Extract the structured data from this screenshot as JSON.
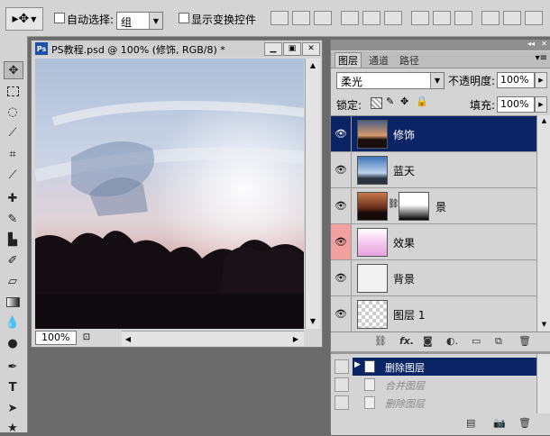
{
  "options_bar": {
    "auto_select_label": "自动选择:",
    "auto_select_value": "组",
    "show_transform_label": "显示变换控件"
  },
  "document": {
    "title": "PS教程.psd @ 100% (修饰, RGB/8) *",
    "zoom": "100%"
  },
  "layers_panel": {
    "tabs": [
      "图层",
      "通道",
      "路径"
    ],
    "blend_mode": "柔光",
    "opacity_label": "不透明度:",
    "opacity_value": "100%",
    "lock_label": "锁定:",
    "fill_label": "填充:",
    "fill_value": "100%",
    "layers": [
      {
        "name": "修饰",
        "selected": true,
        "thumb": "sunset"
      },
      {
        "name": "蓝天",
        "selected": false,
        "thumb": "sky"
      },
      {
        "name": "景",
        "selected": false,
        "thumb": "landscape",
        "has_mask": true
      },
      {
        "name": "效果",
        "selected": false,
        "thumb": "pink",
        "eye_highlight": "#f2a0a0"
      },
      {
        "name": "背景",
        "selected": false,
        "thumb": "white"
      },
      {
        "name": "图层 1",
        "selected": false,
        "thumb": "transparent"
      }
    ]
  },
  "history_panel": {
    "items": [
      {
        "label": "删除图层",
        "active": true
      },
      {
        "label": "合并图层",
        "active": false
      },
      {
        "label": "删除图层",
        "active": false
      }
    ]
  },
  "colors": {
    "selection": "#0a2466",
    "chrome": "#d4d4d4",
    "workspace": "#6b6b6b"
  }
}
